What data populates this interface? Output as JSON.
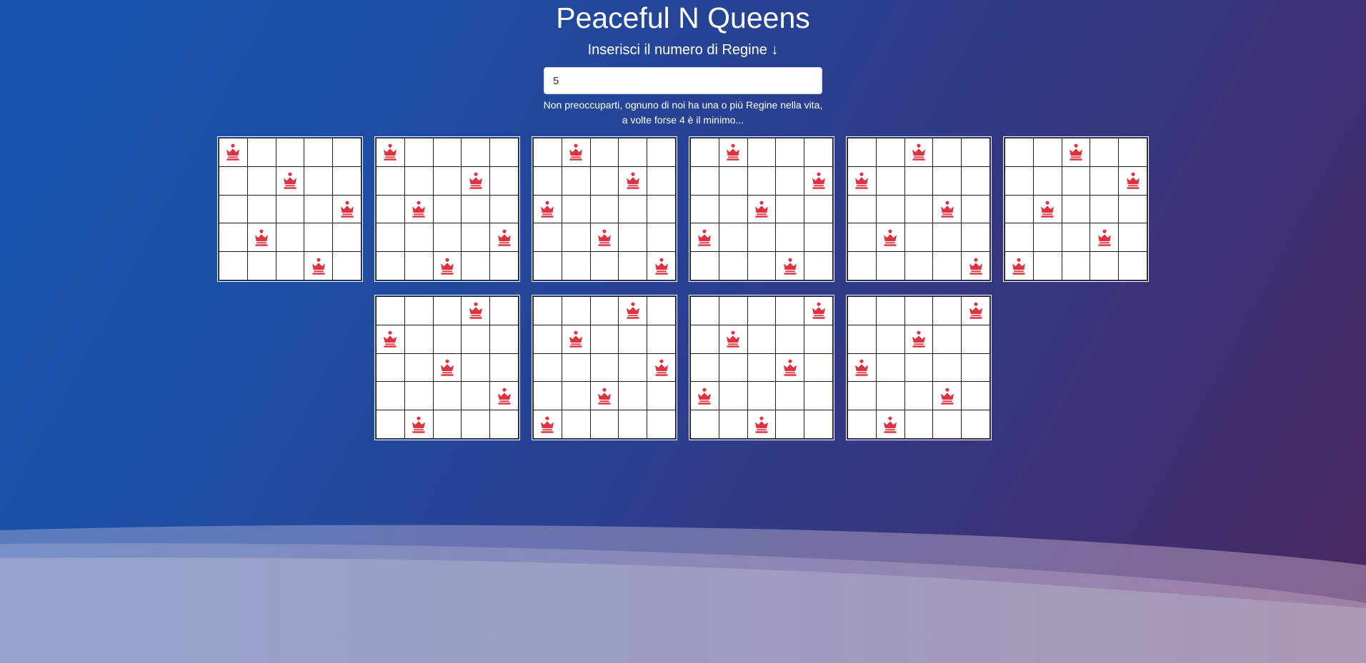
{
  "header": {
    "title": "Peaceful N Queens",
    "subtitle": "Inserisci il numero di Regine ↓"
  },
  "input": {
    "value": "5",
    "placeholder": ""
  },
  "note": {
    "line1": "Non preoccuparti, ognuno di noi ha una o più Regine nella vita,",
    "line2": "a volte forse 4 è il minimo..."
  },
  "icons": {
    "queen": "chess-queen-icon"
  },
  "colors": {
    "queen": "#de3341",
    "board_line": "#1a1a1a",
    "cell": "#ffffff"
  },
  "board_size": 5,
  "solutions": [
    [
      0,
      2,
      4,
      1,
      3
    ],
    [
      0,
      3,
      1,
      4,
      2
    ],
    [
      1,
      3,
      0,
      2,
      4
    ],
    [
      1,
      4,
      2,
      0,
      3
    ],
    [
      2,
      0,
      3,
      1,
      4
    ],
    [
      2,
      4,
      1,
      3,
      0
    ],
    [
      3,
      0,
      2,
      4,
      1
    ],
    [
      3,
      1,
      4,
      2,
      0
    ],
    [
      4,
      1,
      3,
      0,
      2
    ],
    [
      4,
      2,
      0,
      3,
      1
    ]
  ]
}
